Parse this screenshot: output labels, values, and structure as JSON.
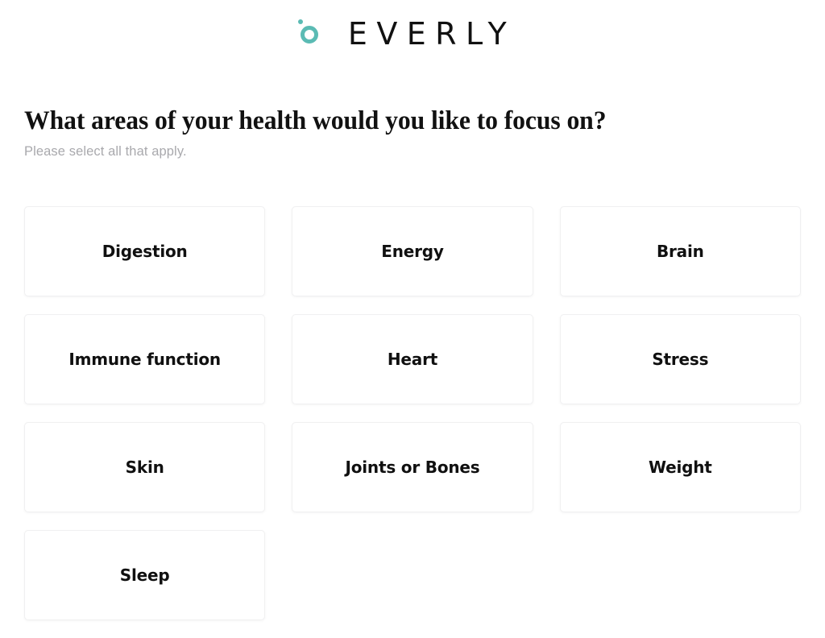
{
  "brand": {
    "logo_icon": "everly-ring-icon",
    "wordmark": "EVERLY",
    "accent_color": "#5bbbb4"
  },
  "question": {
    "title": "What areas of your health would you like to focus on?",
    "subtitle": "Please select all that apply."
  },
  "options": [
    {
      "label": "Digestion"
    },
    {
      "label": "Energy"
    },
    {
      "label": "Brain"
    },
    {
      "label": "Immune function"
    },
    {
      "label": "Heart"
    },
    {
      "label": "Stress"
    },
    {
      "label": "Skin"
    },
    {
      "label": "Joints or Bones"
    },
    {
      "label": "Weight"
    },
    {
      "label": "Sleep"
    }
  ]
}
